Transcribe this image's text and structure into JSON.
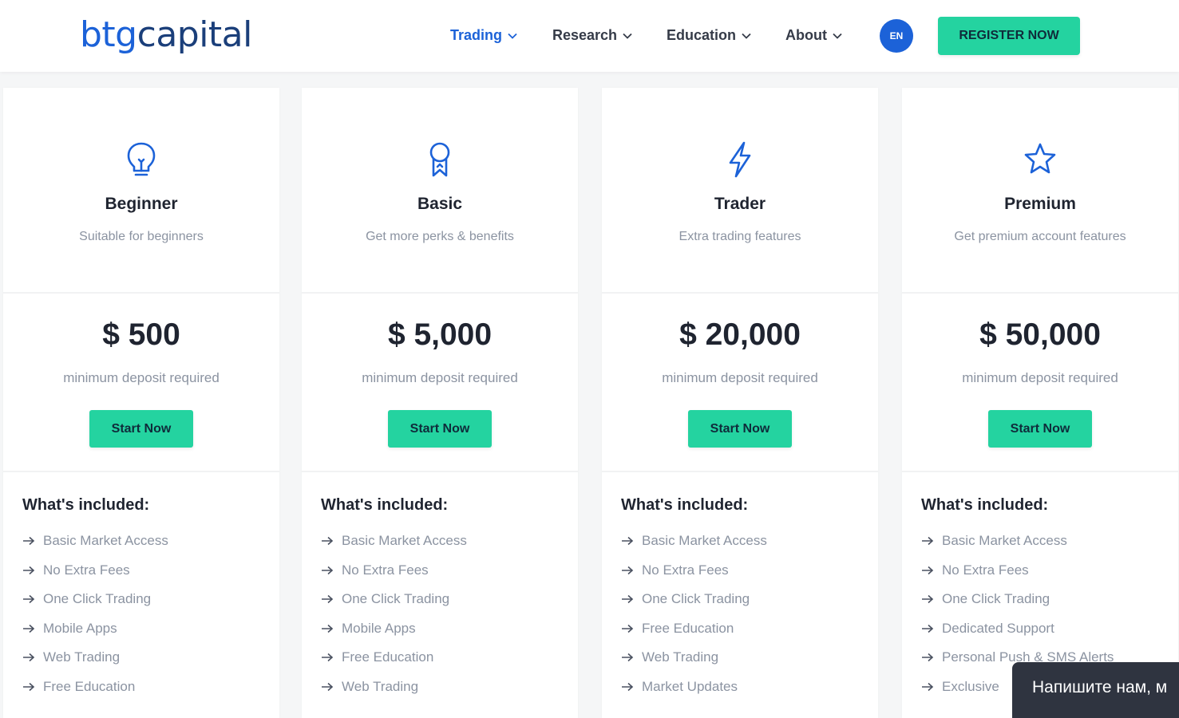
{
  "header": {
    "logo_part1": "btg",
    "logo_part2": "capital",
    "nav": [
      {
        "label": "Trading",
        "active": true
      },
      {
        "label": "Research",
        "active": false
      },
      {
        "label": "Education",
        "active": false
      },
      {
        "label": "About",
        "active": false
      }
    ],
    "lang": "EN",
    "register": "REGISTER NOW"
  },
  "colors": {
    "primary": "#1c62d8",
    "accent_green": "#24d3a0",
    "muted_text": "#8b93a1"
  },
  "plans": [
    {
      "icon": "lightbulb-icon",
      "name": "Beginner",
      "subtitle": "Suitable for beginners",
      "price": "$ 500",
      "price_note": "minimum deposit required",
      "cta": "Start Now",
      "included_title": "What's included:",
      "features": [
        "Basic Market Access",
        "No Extra Fees",
        "One Click Trading",
        "Mobile Apps",
        "Web Trading",
        "Free Education"
      ]
    },
    {
      "icon": "award-ribbon-icon",
      "name": "Basic",
      "subtitle": "Get more perks & benefits",
      "price": "$ 5,000",
      "price_note": "minimum deposit required",
      "cta": "Start Now",
      "included_title": "What's included:",
      "features": [
        "Basic Market Access",
        "No Extra Fees",
        "One Click Trading",
        "Mobile Apps",
        "Free Education",
        "Web Trading"
      ]
    },
    {
      "icon": "lightning-bolt-icon",
      "name": "Trader",
      "subtitle": "Extra trading features",
      "price": "$ 20,000",
      "price_note": "minimum deposit required",
      "cta": "Start Now",
      "included_title": "What's included:",
      "features": [
        "Basic Market Access",
        "No Extra Fees",
        "One Click Trading",
        "Free Education",
        "Web Trading",
        "Market Updates"
      ]
    },
    {
      "icon": "star-icon",
      "name": "Premium",
      "subtitle": "Get premium account features",
      "price": "$ 50,000",
      "price_note": "minimum deposit required",
      "cta": "Start Now",
      "included_title": "What's included:",
      "features": [
        "Basic Market Access",
        "No Extra Fees",
        "One Click Trading",
        "Dedicated Support",
        "Personal Push & SMS Alerts",
        "Exclusive"
      ]
    }
  ],
  "chat": {
    "label": "Напишите нам, м"
  }
}
